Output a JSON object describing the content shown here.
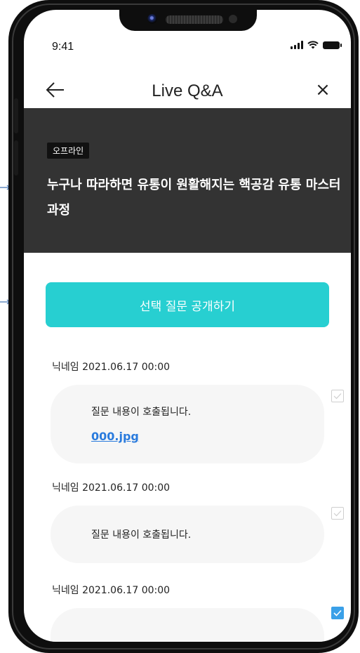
{
  "status_bar": {
    "time": "9:41"
  },
  "header": {
    "title": "Live Q&A",
    "back_icon": "arrow-left-icon",
    "close_icon": "close-icon",
    "close_symbol": "×"
  },
  "banner": {
    "tag": "오프라인",
    "title": "누구나 따라하면 유통이 원활해지는 핵공감 유통 마스터 과정",
    "background": "#333333"
  },
  "actions": {
    "publish_label": "선택 질문 공개하기",
    "accent_color": "#27cfd1"
  },
  "questions": [
    {
      "meta": "닉네임 2021.06.17  00:00",
      "text": "질문 내용이 호출됩니다.",
      "attachment": "000.jpg",
      "checked": false
    },
    {
      "meta": "닉네임 2021.06.17  00:00",
      "text": "질문 내용이 호출됩니다.",
      "checked": false
    },
    {
      "meta": "닉네임 2021.06.17  00:00",
      "text": "",
      "checked": true
    }
  ]
}
